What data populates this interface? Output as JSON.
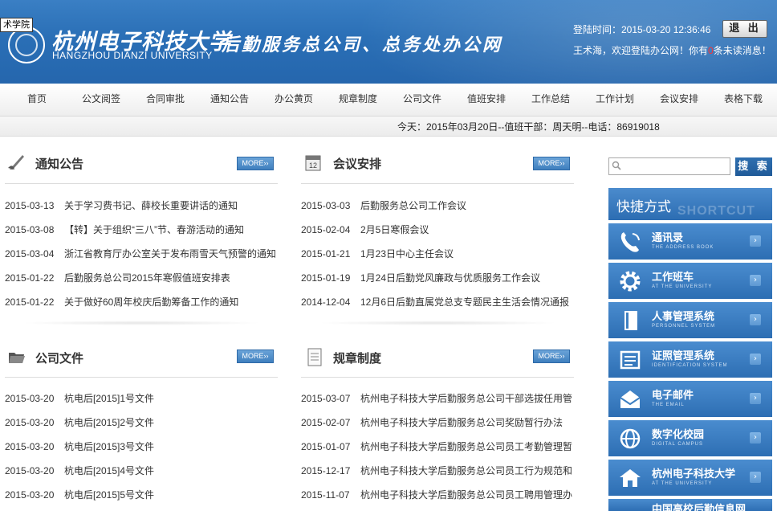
{
  "header": {
    "corner_tag": "术学院",
    "logo_cn": "杭州电子科技大学",
    "logo_en": "HANGZHOU DIANZI UNIVERSITY",
    "slogan": "后勤服务总公司、总务处办公网",
    "login_time": "登陆时间：2015-03-20 12:36:46",
    "logout_label": "退 出",
    "welcome_prefix": "王术海，欢迎登陆办公网！你有",
    "unread_count": "0",
    "welcome_suffix": "条未读消息！"
  },
  "nav": [
    "首页",
    "公文阅签",
    "合同审批",
    "通知公告",
    "办公黄页",
    "规章制度",
    "公司文件",
    "值班安排",
    "工作总结",
    "工作计划",
    "会议安排",
    "表格下载"
  ],
  "duty_bar": "今天：2015年03月20日--值班干部：周天明--电话：86919018",
  "more_label": "MORE››",
  "panels": {
    "notices": {
      "title": "通知公告",
      "items": [
        {
          "date": "2015-03-13",
          "title": "关于学习费书记、薛校长重要讲话的通知"
        },
        {
          "date": "2015-03-08",
          "title": "【转】关于组织“三八”节、春游活动的通知"
        },
        {
          "date": "2015-03-04",
          "title": "浙江省教育厅办公室关于发布雨雪天气预警的通知"
        },
        {
          "date": "2015-01-22",
          "title": "后勤服务总公司2015年寒假值班安排表"
        },
        {
          "date": "2015-01-22",
          "title": "关于做好60周年校庆后勤筹备工作的通知"
        }
      ]
    },
    "meetings": {
      "title": "会议安排",
      "items": [
        {
          "date": "2015-03-03",
          "title": "后勤服务总公司工作会议"
        },
        {
          "date": "2015-02-04",
          "title": "2月5日寒假会议"
        },
        {
          "date": "2015-01-21",
          "title": "1月23日中心主任会议"
        },
        {
          "date": "2015-01-19",
          "title": "1月24日后勤党风廉政与优质服务工作会议"
        },
        {
          "date": "2014-12-04",
          "title": "12月6日后勤直属党总支专题民主生活会情况通报"
        }
      ]
    },
    "files": {
      "title": "公司文件",
      "items": [
        {
          "date": "2015-03-20",
          "title": "杭电后[2015]1号文件"
        },
        {
          "date": "2015-03-20",
          "title": "杭电后[2015]2号文件"
        },
        {
          "date": "2015-03-20",
          "title": "杭电后[2015]3号文件"
        },
        {
          "date": "2015-03-20",
          "title": "杭电后[2015]4号文件"
        },
        {
          "date": "2015-03-20",
          "title": "杭电后[2015]5号文件"
        }
      ]
    },
    "rules": {
      "title": "规章制度",
      "items": [
        {
          "date": "2015-03-07",
          "title": "杭州电子科技大学后勤服务总公司干部选拔任用管"
        },
        {
          "date": "2015-02-07",
          "title": "杭州电子科技大学后勤服务总公司奖励暂行办法"
        },
        {
          "date": "2015-01-07",
          "title": "杭州电子科技大学后勤服务总公司员工考勤管理暂"
        },
        {
          "date": "2015-12-17",
          "title": "杭州电子科技大学后勤服务总公司员工行为规范和"
        },
        {
          "date": "2015-11-07",
          "title": "杭州电子科技大学后勤服务总公司员工聘用管理办"
        }
      ]
    }
  },
  "search": {
    "placeholder": "",
    "button_label": "搜 索"
  },
  "shortcuts": {
    "title": "快捷方式",
    "ghost": "SHORTCUT",
    "items": [
      {
        "label": "通讯录",
        "sub": "THE ADDRESS BOOK",
        "icon": "phone-icon"
      },
      {
        "label": "工作班车",
        "sub": "AT THE UNIVERSITY",
        "icon": "gear-icon"
      },
      {
        "label": "人事管理系统",
        "sub": "PERSONNEL SYSTEM",
        "icon": "book-icon"
      },
      {
        "label": "证照管理系统",
        "sub": "IDENTIFICATION SYSTEM",
        "icon": "id-card-icon"
      },
      {
        "label": "电子邮件",
        "sub": "THE EMAIL",
        "icon": "mail-icon"
      },
      {
        "label": "数字化校园",
        "sub": "DIGITAL CAMPUS",
        "icon": "globe-icon"
      },
      {
        "label": "杭州电子科技大学",
        "sub": "AT THE UNIVERSITY",
        "icon": "house-icon"
      },
      {
        "label": "中国高校后勤信息网",
        "sub": "",
        "icon": "link-icon"
      }
    ]
  }
}
